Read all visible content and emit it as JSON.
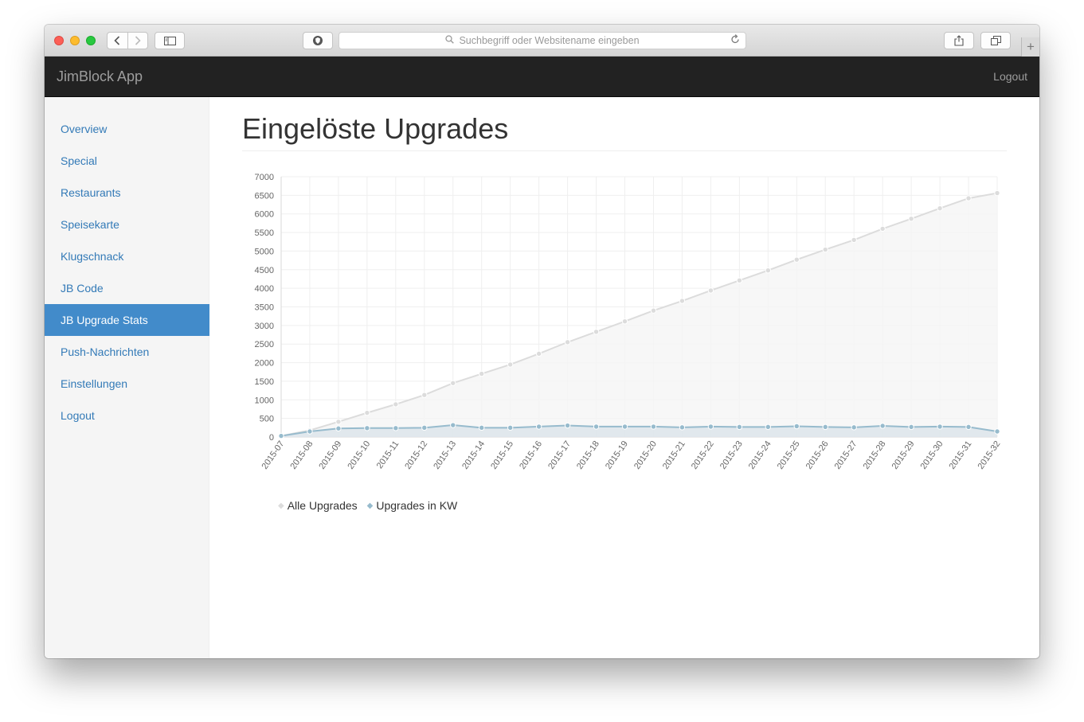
{
  "browser": {
    "address_placeholder": "Suchbegriff oder Websitename eingeben"
  },
  "navbar": {
    "brand": "JimBlock App",
    "logout": "Logout"
  },
  "sidebar": {
    "items": [
      {
        "label": "Overview",
        "active": false
      },
      {
        "label": "Special",
        "active": false
      },
      {
        "label": "Restaurants",
        "active": false
      },
      {
        "label": "Speisekarte",
        "active": false
      },
      {
        "label": "Klugschnack",
        "active": false
      },
      {
        "label": "JB Code",
        "active": false
      },
      {
        "label": "JB Upgrade Stats",
        "active": true
      },
      {
        "label": "Push-Nachrichten",
        "active": false
      },
      {
        "label": "Einstellungen",
        "active": false
      },
      {
        "label": "Logout",
        "active": false
      }
    ]
  },
  "page": {
    "title": "Eingelöste Upgrades"
  },
  "chart_data": {
    "type": "line",
    "title": "",
    "xlabel": "",
    "ylabel": "",
    "ylim": [
      0,
      7000
    ],
    "y_ticks": [
      0,
      500,
      1000,
      1500,
      2000,
      2500,
      3000,
      3500,
      4000,
      4500,
      5000,
      5500,
      6000,
      6500,
      7000
    ],
    "grid": true,
    "legend_position": "bottom-left",
    "categories": [
      "2015-07",
      "2015-08",
      "2015-09",
      "2015-10",
      "2015-11",
      "2015-12",
      "2015-13",
      "2015-14",
      "2015-15",
      "2015-16",
      "2015-17",
      "2015-18",
      "2015-19",
      "2015-20",
      "2015-21",
      "2015-22",
      "2015-23",
      "2015-24",
      "2015-25",
      "2015-26",
      "2015-27",
      "2015-28",
      "2015-29",
      "2015-30",
      "2015-31",
      "2015-32"
    ],
    "series": [
      {
        "name": "Alle Upgrades",
        "color": "#dcdcdc",
        "fill": "#f5f5f5",
        "values": [
          30,
          180,
          410,
          650,
          880,
          1130,
          1450,
          1700,
          1950,
          2240,
          2550,
          2830,
          3110,
          3400,
          3660,
          3940,
          4210,
          4480,
          4770,
          5040,
          5300,
          5600,
          5870,
          6150,
          6420,
          6560
        ]
      },
      {
        "name": "Upgrades in KW",
        "color": "#97bbcd",
        "fill": "#cfdde6",
        "values": [
          30,
          150,
          230,
          240,
          240,
          250,
          320,
          250,
          250,
          280,
          310,
          280,
          280,
          280,
          260,
          280,
          270,
          270,
          290,
          270,
          260,
          300,
          270,
          280,
          270,
          150
        ]
      }
    ]
  }
}
